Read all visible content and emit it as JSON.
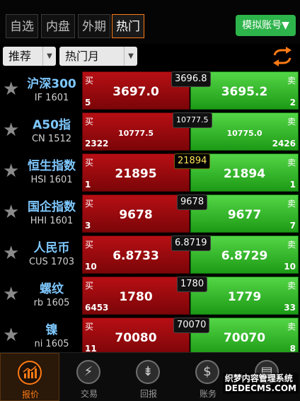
{
  "tabs": [
    {
      "label": "自选",
      "active": false
    },
    {
      "label": "内盘",
      "active": false
    },
    {
      "label": "外期",
      "active": false
    },
    {
      "label": "热门",
      "active": true
    }
  ],
  "sim_account_label": "模拟账号▼",
  "filters": {
    "recommend": "推荐",
    "month": "热门月"
  },
  "buy_tag": "买",
  "sell_tag": "卖",
  "rows": [
    {
      "name": "沪深300",
      "code": "IF 1601",
      "buy": "3697.0",
      "buy_vol": "5",
      "sell": "3695.2",
      "sell_vol": "2",
      "last": "3696.8"
    },
    {
      "name": "A50指",
      "code": "CN 1512",
      "buy": "10777.5",
      "buy_vol": "2322",
      "sell": "10775.0",
      "sell_vol": "2426",
      "last": "10777.5"
    },
    {
      "name": "恒生指数",
      "code": "HSI 1601",
      "buy": "21895",
      "buy_vol": "1",
      "sell": "21894",
      "sell_vol": "1",
      "last": "21894"
    },
    {
      "name": "国企指数",
      "code": "HHI 1601",
      "buy": "9678",
      "buy_vol": "3",
      "sell": "9677",
      "sell_vol": "7",
      "last": "9678"
    },
    {
      "name": "人民币",
      "code": "CUS 1703",
      "buy": "6.8733",
      "buy_vol": "10",
      "sell": "6.8729",
      "sell_vol": "10",
      "last": "6.8719"
    },
    {
      "name": "螺纹",
      "code": "rb 1605",
      "buy": "1780",
      "buy_vol": "6453",
      "sell": "1779",
      "sell_vol": "33",
      "last": "1780"
    },
    {
      "name": "镍",
      "code": "ni 1605",
      "buy": "70080",
      "buy_vol": "11",
      "sell": "70070",
      "sell_vol": "8",
      "last": "70070"
    }
  ],
  "nav": [
    {
      "label": "报价",
      "icon": "chart-icon",
      "active": true
    },
    {
      "label": "交易",
      "icon": "lightning-icon",
      "active": false
    },
    {
      "label": "回报",
      "icon": "report-icon",
      "active": false
    },
    {
      "label": "账务",
      "icon": "dollar-icon",
      "active": false
    },
    {
      "label": "",
      "icon": "settings-icon",
      "active": false
    }
  ],
  "watermark": "织梦内容管理系统\nDEDECMS.COM",
  "colors": {
    "accent": "#ff7a14",
    "buy": "#b70f14",
    "sell": "#2db44b",
    "sim": "#2db44b",
    "name": "#7ec8ff",
    "highlight": "#ffe45a"
  }
}
